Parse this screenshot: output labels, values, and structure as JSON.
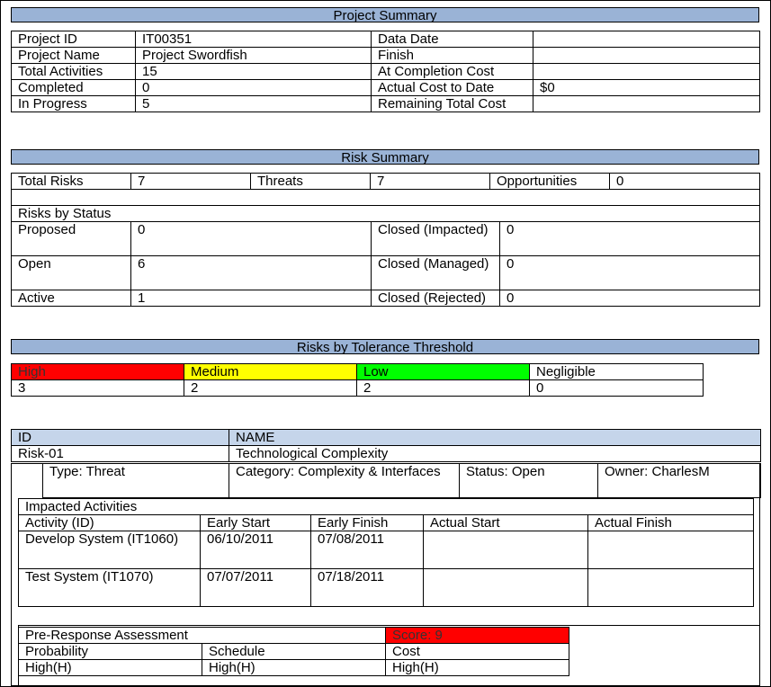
{
  "project_summary": {
    "title": "Project Summary",
    "rows": [
      {
        "label": "Project ID",
        "value": "IT00351",
        "label2": "Data Date",
        "value2": ""
      },
      {
        "label": "Project Name",
        "value": "Project Swordfish",
        "label2": "Finish",
        "value2": ""
      },
      {
        "label": "Total Activities",
        "value": "15",
        "label2": "At Completion Cost",
        "value2": ""
      },
      {
        "label": "Completed",
        "value": "0",
        "label2": "Actual Cost to Date",
        "value2": "$0"
      },
      {
        "label": "In Progress",
        "value": "5",
        "label2": "Remaining Total Cost",
        "value2": ""
      }
    ]
  },
  "risk_summary": {
    "title": "Risk Summary",
    "total_risks_label": "Total Risks",
    "total_risks": "7",
    "threats_label": "Threats",
    "threats": "7",
    "opportunities_label": "Opportunities",
    "opportunities": "0",
    "by_status_label": "Risks by Status",
    "status": [
      {
        "label": "Proposed",
        "value": "0",
        "label2": "Closed (Impacted)",
        "value2": "0"
      },
      {
        "label": "Open",
        "value": "6",
        "label2": "Closed (Managed)",
        "value2": "0"
      },
      {
        "label": "Active",
        "value": "1",
        "label2": "Closed (Rejected)",
        "value2": "0"
      }
    ]
  },
  "tolerance": {
    "title": "Risks by Tolerance Threshold",
    "levels": [
      {
        "label": "High",
        "value": "3",
        "color": "#ff0000"
      },
      {
        "label": "Medium",
        "value": "2",
        "color": "#ffff00"
      },
      {
        "label": "Low",
        "value": "2",
        "color": "#00ff00"
      },
      {
        "label": "Negligible",
        "value": "0",
        "color": "#ffffff"
      }
    ]
  },
  "risk_detail": {
    "id_label": "ID",
    "name_label": "NAME",
    "id": "Risk-01",
    "name": "Technological Complexity",
    "type": "Type: Threat",
    "category": "Category: Complexity & Interfaces",
    "status": "Status: Open",
    "owner": "Owner: CharlesM",
    "impacted_title": "Impacted Activities",
    "columns": [
      "Activity (ID)",
      "Early Start",
      "Early Finish",
      "Actual Start",
      "Actual Finish"
    ],
    "activities": [
      [
        "Develop System (IT1060)",
        "06/10/2011",
        "07/08/2011",
        "",
        ""
      ],
      [
        "Test System (IT1070)",
        "07/07/2011",
        "07/18/2011",
        "",
        ""
      ]
    ],
    "pre_response_label": "Pre-Response Assessment",
    "score": "Score: 9",
    "score_color": "#ff0000",
    "assessment_headers": [
      "Probability",
      "Schedule",
      "Cost"
    ],
    "assessment_values": [
      "High(H)",
      "High(H)",
      "High(H)"
    ]
  }
}
